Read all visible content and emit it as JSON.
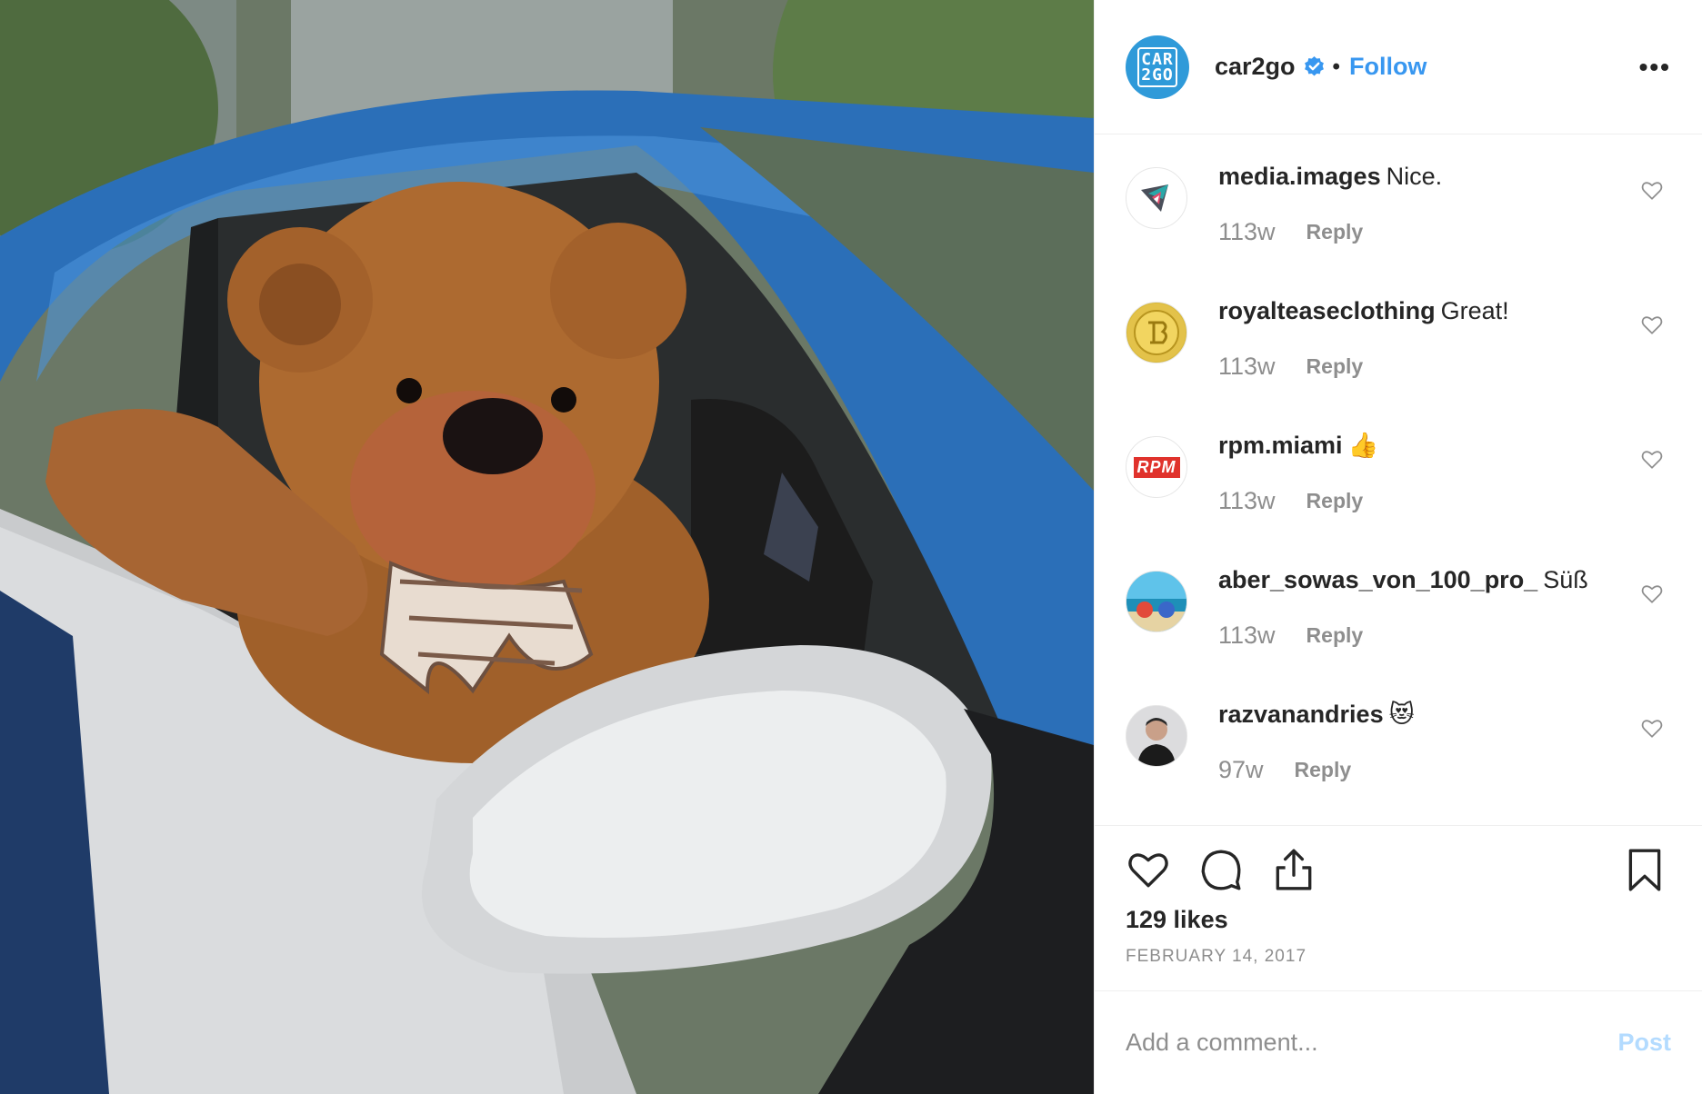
{
  "header": {
    "username": "car2go",
    "dot": "•",
    "follow_label": "Follow",
    "more_label": "•••",
    "avatar_text_line1": "CAR",
    "avatar_text_line2": "2GO"
  },
  "comments": [
    {
      "username": "media.images",
      "text": "Nice.",
      "time": "113w",
      "reply": "Reply",
      "avatar_icon": "media-images-logo-icon"
    },
    {
      "username": "royalteaseclothing",
      "text": "Great!",
      "time": "113w",
      "reply": "Reply",
      "avatar_icon": "royaltease-logo-icon"
    },
    {
      "username": "rpm.miami",
      "text": "👍",
      "time": "113w",
      "reply": "Reply",
      "avatar_icon": "rpm-logo-icon",
      "avatar_label": "RPM"
    },
    {
      "username": "aber_sowas_von_100_pro_",
      "text": "Süß",
      "time": "113w",
      "reply": "Reply",
      "avatar_icon": "beach-photo-icon"
    },
    {
      "username": "razvanandries",
      "text": "😻",
      "time": "97w",
      "reply": "Reply",
      "avatar_icon": "person-photo-icon"
    }
  ],
  "actions": {
    "likes": "129 likes",
    "date": "FEBRUARY 14, 2017",
    "icons": [
      "heart-icon",
      "comment-icon",
      "share-icon",
      "bookmark-icon"
    ]
  },
  "add_comment": {
    "placeholder": "Add a comment...",
    "post_label": "Post"
  },
  "colors": {
    "link_blue": "#3897f0",
    "post_disabled": "#b3dbff",
    "text": "#262626",
    "muted": "#8e8e8e",
    "avatar_blue": "#2f9ad9"
  }
}
